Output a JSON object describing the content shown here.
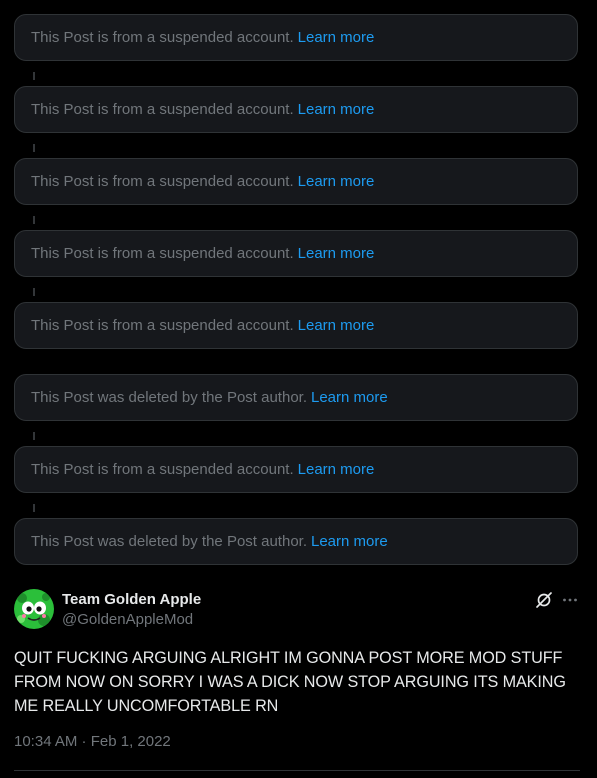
{
  "thread": {
    "tombstones": [
      {
        "text": "This Post is from a suspended account.",
        "link": "Learn more"
      },
      {
        "text": "This Post is from a suspended account.",
        "link": "Learn more"
      },
      {
        "text": "This Post is from a suspended account.",
        "link": "Learn more"
      },
      {
        "text": "This Post is from a suspended account.",
        "link": "Learn more"
      },
      {
        "text": "This Post is from a suspended account.",
        "link": "Learn more"
      },
      {
        "text": "This Post was deleted by the Post author.",
        "link": "Learn more"
      },
      {
        "text": "This Post is from a suspended account.",
        "link": "Learn more"
      },
      {
        "text": "This Post was deleted by the Post author.",
        "link": "Learn more"
      }
    ]
  },
  "tweet": {
    "display_name": "Team Golden Apple",
    "handle": "@GoldenAppleMod",
    "text": "QUIT FUCKING ARGUING ALRIGHT IM GONNA POST MORE MOD STUFF FROM NOW ON SORRY I WAS A DICK NOW STOP ARGUING ITS MAKING ME REALLY UNCOMFORTABLE RN",
    "timestamp": "10:34 AM · Feb 1, 2022",
    "icons": [
      "grok-icon",
      "more-icon"
    ]
  },
  "colors": {
    "background": "#000000",
    "card": "#16181c",
    "border": "#2f3336",
    "muted_text": "#71767b",
    "link": "#1d9bf0",
    "primary_text": "#e7e9ea"
  }
}
